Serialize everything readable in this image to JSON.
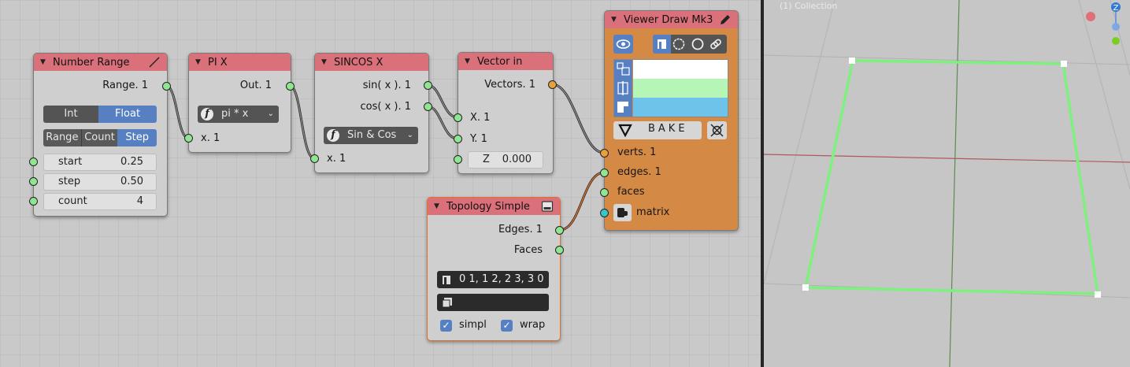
{
  "nodes": {
    "number_range": {
      "title": "Number Range",
      "output": "Range. 1",
      "mode_buttons": [
        "Int",
        "Float"
      ],
      "mode_selected": "Float",
      "type_buttons": [
        "Range",
        "Count",
        "Step"
      ],
      "type_selected": "Step",
      "fields": [
        {
          "label": "start",
          "value": "0.25"
        },
        {
          "label": "step",
          "value": "0.50"
        },
        {
          "label": "count",
          "value": "4"
        }
      ]
    },
    "pi_x": {
      "title": "PI X",
      "output": "Out. 1",
      "function": "pi * x",
      "input": "x. 1"
    },
    "sincos_x": {
      "title": "SINCOS X",
      "outputs": [
        "sin( x ). 1",
        "cos( x ). 1"
      ],
      "function": "Sin & Cos",
      "input": "x. 1"
    },
    "vector_in": {
      "title": "Vector in",
      "output": "Vectors. 1",
      "inputs": [
        "X. 1",
        "Y. 1"
      ],
      "z_label": "Z",
      "z_value": "0.000"
    },
    "viewer_draw": {
      "title": "Viewer Draw Mk3",
      "bake_label": "BAKE",
      "color_rows": [
        "#ffffff",
        "#b5f5b5",
        "#6ec3ea"
      ],
      "inputs": [
        "verts. 1",
        "edges. 1",
        "faces",
        "matrix"
      ],
      "body_color": "#d48a45"
    },
    "topology_simple": {
      "title": "Topology Simple",
      "outputs": [
        "Edges. 1",
        "Faces"
      ],
      "edges_text": "0 1, 1 2, 2 3, 3 0",
      "faces_text": "",
      "checks": [
        {
          "label": "simpl",
          "checked": true
        },
        {
          "label": "wrap",
          "checked": true
        }
      ]
    }
  },
  "viewport": {
    "collection_label": "(1) Collection",
    "gizmo_z": "Z",
    "mesh_color": "#7ef07e"
  },
  "colors": {
    "header": "#d9707a",
    "socket_green": "#90e590",
    "socket_orange": "#e8a13a",
    "socket_cyan": "#35c8c8",
    "selected_blue": "#5680c2",
    "active_outline": "#e0702a"
  }
}
